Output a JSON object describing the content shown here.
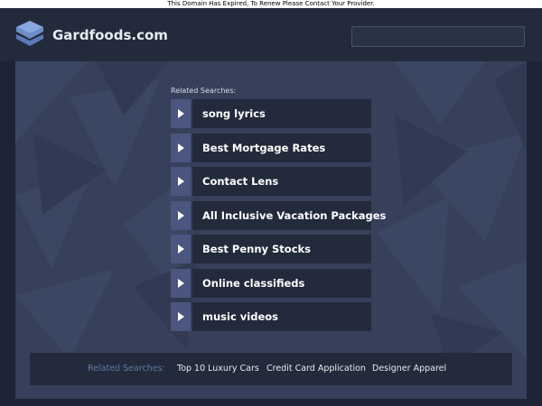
{
  "notice": "This Domain Has Expired, To Renew Please Contact Your Provider.",
  "header": {
    "site_name": "Gardfoods.com",
    "logo_icon": "layers-stack-icon",
    "search_placeholder": ""
  },
  "main": {
    "related_title": "Related Searches:",
    "links": [
      {
        "label": "song lyrics"
      },
      {
        "label": "Best Mortgage Rates"
      },
      {
        "label": "Contact Lens"
      },
      {
        "label": "All Inclusive Vacation Packages"
      },
      {
        "label": "Best Penny Stocks"
      },
      {
        "label": "Online classifieds"
      },
      {
        "label": "music videos"
      }
    ]
  },
  "bottom": {
    "title": "Related Searches:",
    "links": [
      {
        "label": "Top 10 Luxury Cars"
      },
      {
        "label": "Credit Card Application"
      },
      {
        "label": "Designer Apparel"
      }
    ]
  },
  "colors": {
    "page_bg": "#1e2435",
    "panel_bg": "#36405a",
    "bar_bg": "#232a3b",
    "arrow_bg": "#4a5680",
    "bottom_title": "#5e7aa6"
  }
}
